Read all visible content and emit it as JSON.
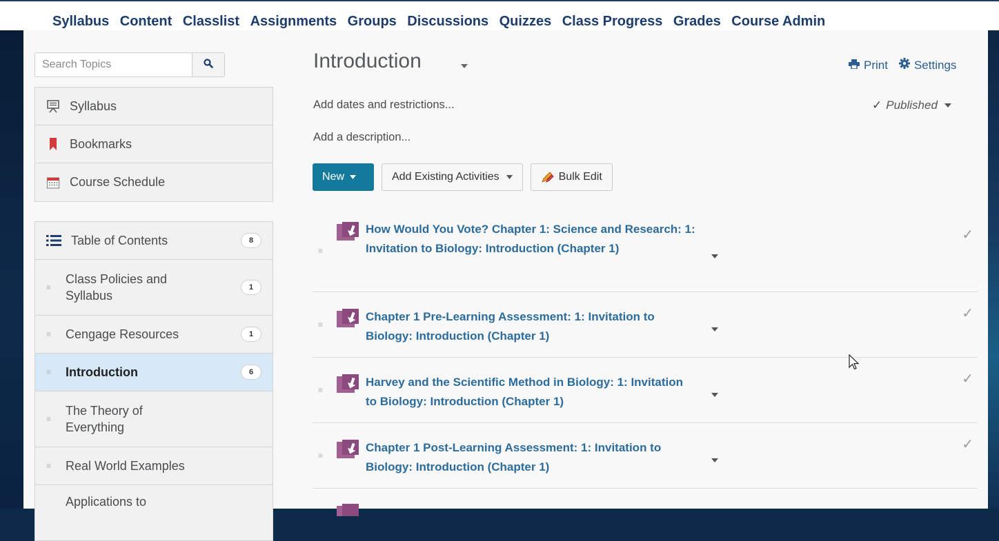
{
  "nav": {
    "items": [
      "Syllabus",
      "Content",
      "Classlist",
      "Assignments",
      "Groups",
      "Discussions",
      "Quizzes",
      "Class Progress",
      "Grades",
      "Course Admin"
    ]
  },
  "search": {
    "placeholder": "Search Topics"
  },
  "tools": [
    {
      "label": "Syllabus",
      "icon": "syllabus-icon"
    },
    {
      "label": "Bookmarks",
      "icon": "bookmark-icon"
    },
    {
      "label": "Course Schedule",
      "icon": "calendar-icon"
    }
  ],
  "toc": {
    "header": {
      "label": "Table of Contents",
      "count": "8"
    },
    "modules": [
      {
        "label": "Class Policies and Syllabus",
        "count": "1",
        "selected": false
      },
      {
        "label": "Cengage Resources",
        "count": "1",
        "selected": false
      },
      {
        "label": "Introduction",
        "count": "6",
        "selected": true
      },
      {
        "label": "The Theory of Everything",
        "count": "",
        "selected": false
      },
      {
        "label": "Real World Examples",
        "count": "",
        "selected": false
      },
      {
        "label": "Applications to",
        "count": "",
        "selected": false
      }
    ]
  },
  "content": {
    "title": "Introduction",
    "print_label": "Print",
    "settings_label": "Settings",
    "dates_link": "Add dates and restrictions...",
    "description_link": "Add a description...",
    "status": "Published",
    "buttons": {
      "new": "New",
      "add_existing": "Add Existing Activities",
      "bulk_edit": "Bulk Edit"
    },
    "activities": [
      {
        "title": "How Would You Vote? Chapter 1: Science and Research: 1: Invitation to Biology: Introduction (Chapter 1)"
      },
      {
        "title": "Chapter 1 Pre-Learning Assessment: 1: Invitation to Biology: Introduction (Chapter 1)"
      },
      {
        "title": "Harvey and the Scientific Method in Biology: 1: Invitation to Biology: Introduction (Chapter 1)"
      },
      {
        "title": "Chapter 1 Post-Learning Assessment: 1: Invitation to Biology: Introduction (Chapter 1)"
      }
    ]
  },
  "colors": {
    "nav_text": "#1d3c6e",
    "link": "#2b6c9c",
    "primary_button": "#137a9c",
    "selected_row": "#d7e9f7"
  }
}
